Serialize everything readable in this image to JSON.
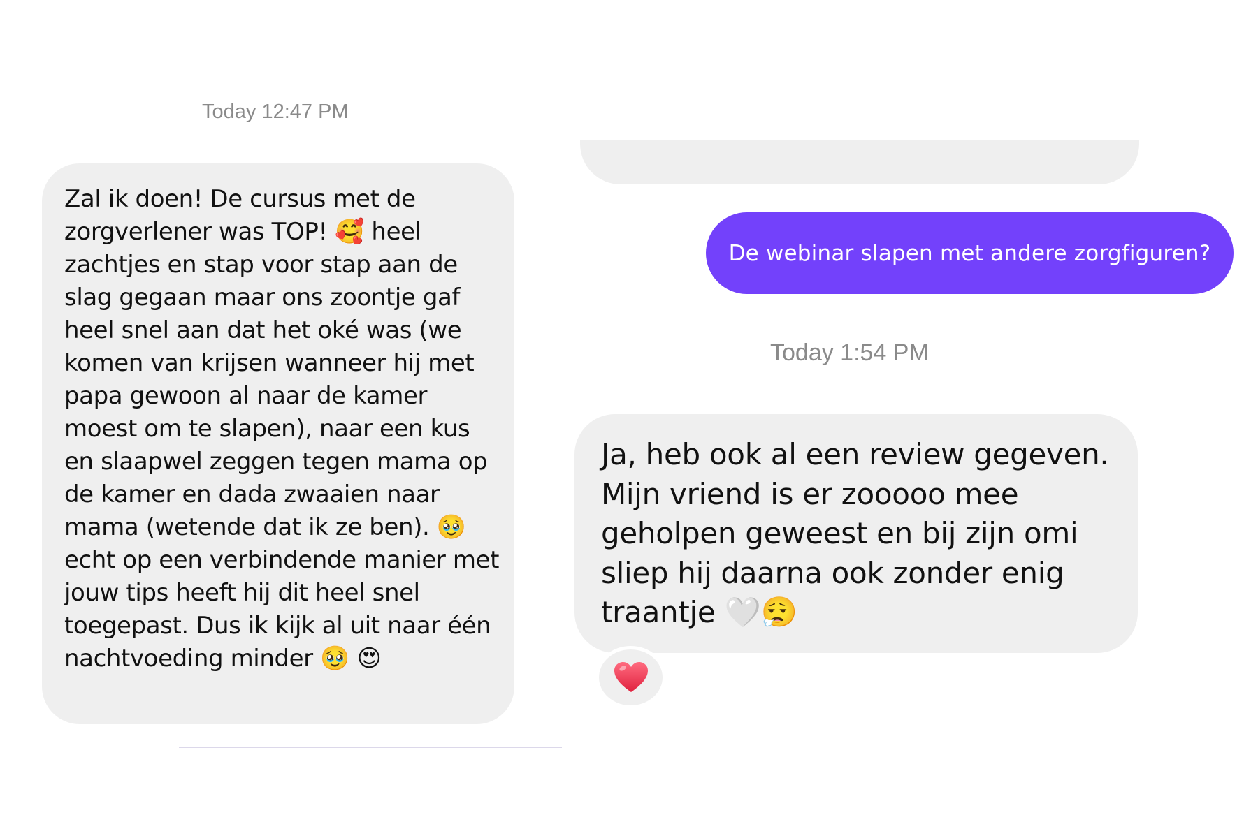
{
  "conversation": {
    "timestamps": {
      "first": "Today 12:47 PM",
      "second": "Today 1:54 PM"
    },
    "messages": {
      "incoming_first": "Zal ik doen! De cursus met de zorgverlener was TOP! 🥰 heel zachtjes en stap voor stap aan de slag gegaan maar ons zoontje gaf heel snel aan dat het oké was (we komen van krijsen wanneer hij met papa gewoon al naar de kamer moest om te slapen), naar een kus en slaapwel zeggen tegen mama op de kamer en dada zwaaien naar mama (wetende dat ik ze ben). 🥹 echt op een verbindende manier met jouw tips heeft hij dit heel snel toegepast. Dus ik kijk al uit naar één nachtvoeding minder 🥹 😍",
      "outgoing": "De webinar slapen met andere zorgfiguren?",
      "incoming_second": "Ja, heb ook al een review gegeven. Mijn vriend is er zooooo mee geholpen geweest en bij zijn omi sliep hij daarna ook zonder enig traantje 🤍😮‍💨"
    },
    "reaction": {
      "icon": "red-heart-icon",
      "glyph": "❤️",
      "color": "#f0455e"
    }
  },
  "colors": {
    "incoming_bubble": "#efefef",
    "outgoing_bubble": "#7341fb",
    "timestamp_text": "#8a8a8a",
    "message_text": "#111111"
  }
}
